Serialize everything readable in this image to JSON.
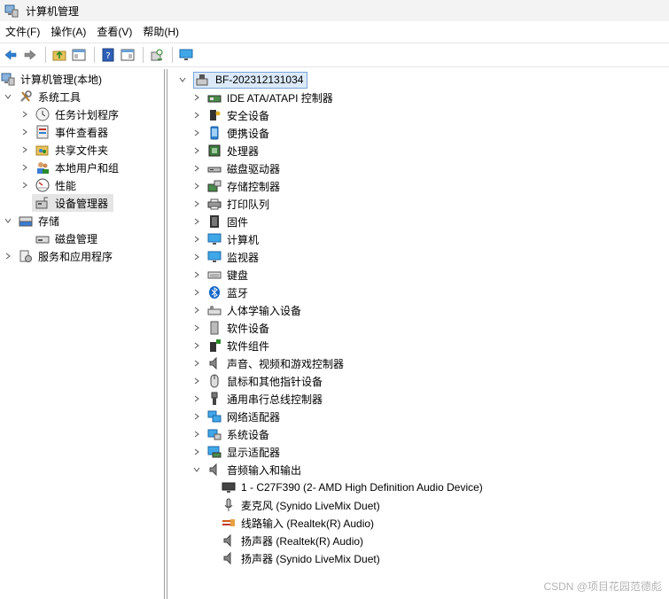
{
  "window": {
    "title": "计算机管理"
  },
  "menu": [
    "文件(F)",
    "操作(A)",
    "查看(V)",
    "帮助(H)"
  ],
  "toolbar": {
    "buttons": [
      "back-icon",
      "forward-icon",
      "up-folder-icon",
      "show-hide-tree-icon",
      "help-icon",
      "action-pane-icon",
      "scan-hardware-icon",
      "device-monitor-icon"
    ]
  },
  "tree": {
    "root": "计算机管理(本地)",
    "system_tools": "系统工具",
    "task_scheduler": "任务计划程序",
    "event_viewer": "事件查看器",
    "shared_folders": "共享文件夹",
    "local_users": "本地用户和组",
    "performance": "性能",
    "device_manager": "设备管理器",
    "storage": "存储",
    "disk_management": "磁盘管理",
    "services_apps": "服务和应用程序"
  },
  "devices": {
    "computer_name": "BF-202312131034",
    "categories": [
      "IDE ATA/ATAPI 控制器",
      "安全设备",
      "便携设备",
      "处理器",
      "磁盘驱动器",
      "存储控制器",
      "打印队列",
      "固件",
      "计算机",
      "监视器",
      "键盘",
      "蓝牙",
      "人体学输入设备",
      "软件设备",
      "软件组件",
      "声音、视频和游戏控制器",
      "鼠标和其他指针设备",
      "通用串行总线控制器",
      "网络适配器",
      "系统设备",
      "显示适配器",
      "音频输入和输出"
    ],
    "audio_children": [
      "1 - C27F390 (2- AMD High Definition Audio Device)",
      "麦克风 (Synido LiveMix Duet)",
      "线路输入 (Realtek(R) Audio)",
      "扬声器 (Realtek(R) Audio)",
      "扬声器 (Synido LiveMix Duet)"
    ]
  },
  "watermark": "CSDN @项目花园范德彪"
}
